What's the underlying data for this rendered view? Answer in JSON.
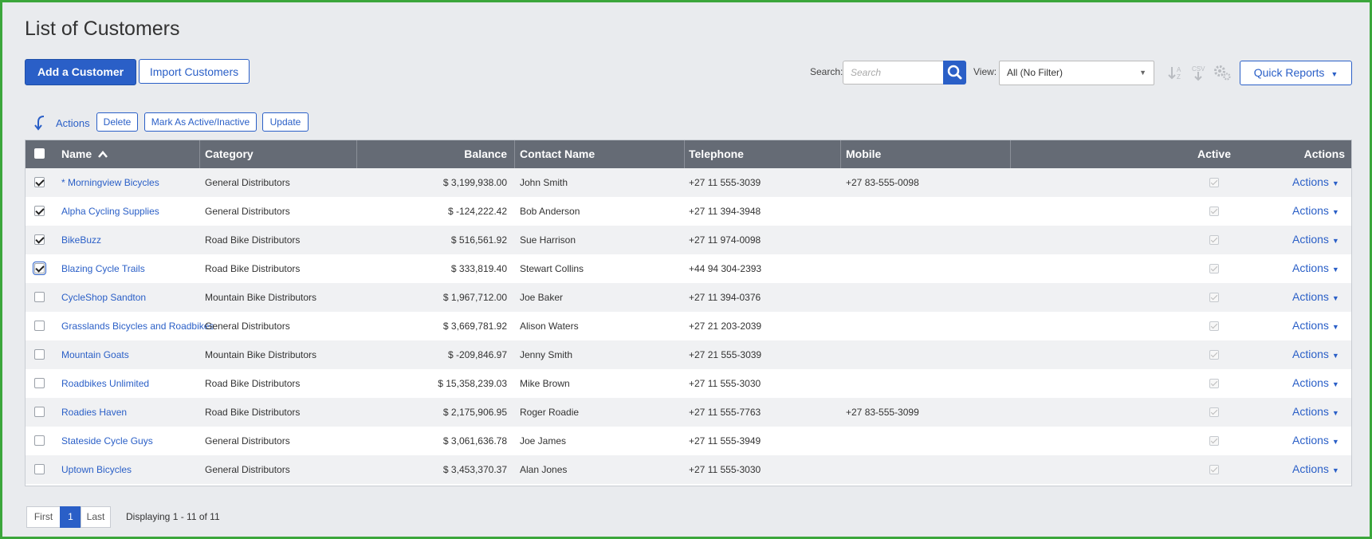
{
  "page_title": "List of Customers",
  "toolbar": {
    "add_label": "Add a Customer",
    "import_label": "Import Customers",
    "search_label": "Search:",
    "search_placeholder": "Search",
    "view_label": "View:",
    "view_value": "All (No Filter)",
    "quick_reports_label": "Quick Reports"
  },
  "bulk_actions": {
    "label": "Actions",
    "delete": "Delete",
    "mark_active": "Mark As Active/Inactive",
    "update": "Update"
  },
  "table": {
    "headers": {
      "name": "Name",
      "category": "Category",
      "balance": "Balance",
      "contact": "Contact Name",
      "telephone": "Telephone",
      "mobile": "Mobile",
      "active": "Active",
      "actions": "Actions"
    },
    "row_action_label": "Actions",
    "rows": [
      {
        "name": "* Morningview Bicycles",
        "category": "General Distributors",
        "balance": "$ 3,199,938.00",
        "contact": "John Smith",
        "telephone": "+27 11 555-3039",
        "mobile": "+27 83-555-0098",
        "selected": true,
        "active": true
      },
      {
        "name": "Alpha Cycling Supplies",
        "category": "General Distributors",
        "balance": "$ -124,222.42",
        "contact": "Bob Anderson",
        "telephone": "+27 11 394-3948",
        "mobile": "",
        "selected": true,
        "active": true
      },
      {
        "name": "BikeBuzz",
        "category": "Road Bike Distributors",
        "balance": "$ 516,561.92",
        "contact": "Sue Harrison",
        "telephone": "+27 11 974-0098",
        "mobile": "",
        "selected": true,
        "active": true
      },
      {
        "name": "Blazing Cycle Trails",
        "category": "Road Bike Distributors",
        "balance": "$ 333,819.40",
        "contact": "Stewart Collins",
        "telephone": "+44 94 304-2393",
        "mobile": "",
        "selected": true,
        "active": true
      },
      {
        "name": "CycleShop Sandton",
        "category": "Mountain Bike Distributors",
        "balance": "$ 1,967,712.00",
        "contact": "Joe Baker",
        "telephone": "+27 11 394-0376",
        "mobile": "",
        "selected": false,
        "active": true
      },
      {
        "name": "Grasslands Bicycles and Roadbikes",
        "category": "General Distributors",
        "balance": "$ 3,669,781.92",
        "contact": "Alison Waters",
        "telephone": "+27 21 203-2039",
        "mobile": "",
        "selected": false,
        "active": true
      },
      {
        "name": "Mountain Goats",
        "category": "Mountain Bike Distributors",
        "balance": "$ -209,846.97",
        "contact": "Jenny Smith",
        "telephone": "+27 21 555-3039",
        "mobile": "",
        "selected": false,
        "active": true
      },
      {
        "name": "Roadbikes Unlimited",
        "category": "Road Bike Distributors",
        "balance": "$ 15,358,239.03",
        "contact": "Mike Brown",
        "telephone": "+27 11 555-3030",
        "mobile": "",
        "selected": false,
        "active": true
      },
      {
        "name": "Roadies Haven",
        "category": "Road Bike Distributors",
        "balance": "$ 2,175,906.95",
        "contact": "Roger Roadie",
        "telephone": "+27 11 555-7763",
        "mobile": "+27 83-555-3099",
        "selected": false,
        "active": true
      },
      {
        "name": "Stateside Cycle Guys",
        "category": "General Distributors",
        "balance": "$ 3,061,636.78",
        "contact": "Joe James",
        "telephone": "+27 11 555-3949",
        "mobile": "",
        "selected": false,
        "active": true
      },
      {
        "name": "Uptown Bicycles",
        "category": "General Distributors",
        "balance": "$ 3,453,370.37",
        "contact": "Alan Jones",
        "telephone": "+27 11 555-3030",
        "mobile": "",
        "selected": false,
        "active": true
      }
    ]
  },
  "pagination": {
    "first": "First",
    "current": "1",
    "last": "Last",
    "info": "Displaying 1 - 11 of 11"
  },
  "colors": {
    "accent": "#2a5fc7",
    "header_bg": "#656b75",
    "page_bg": "#e9ebee",
    "frame": "#3ba63b"
  }
}
